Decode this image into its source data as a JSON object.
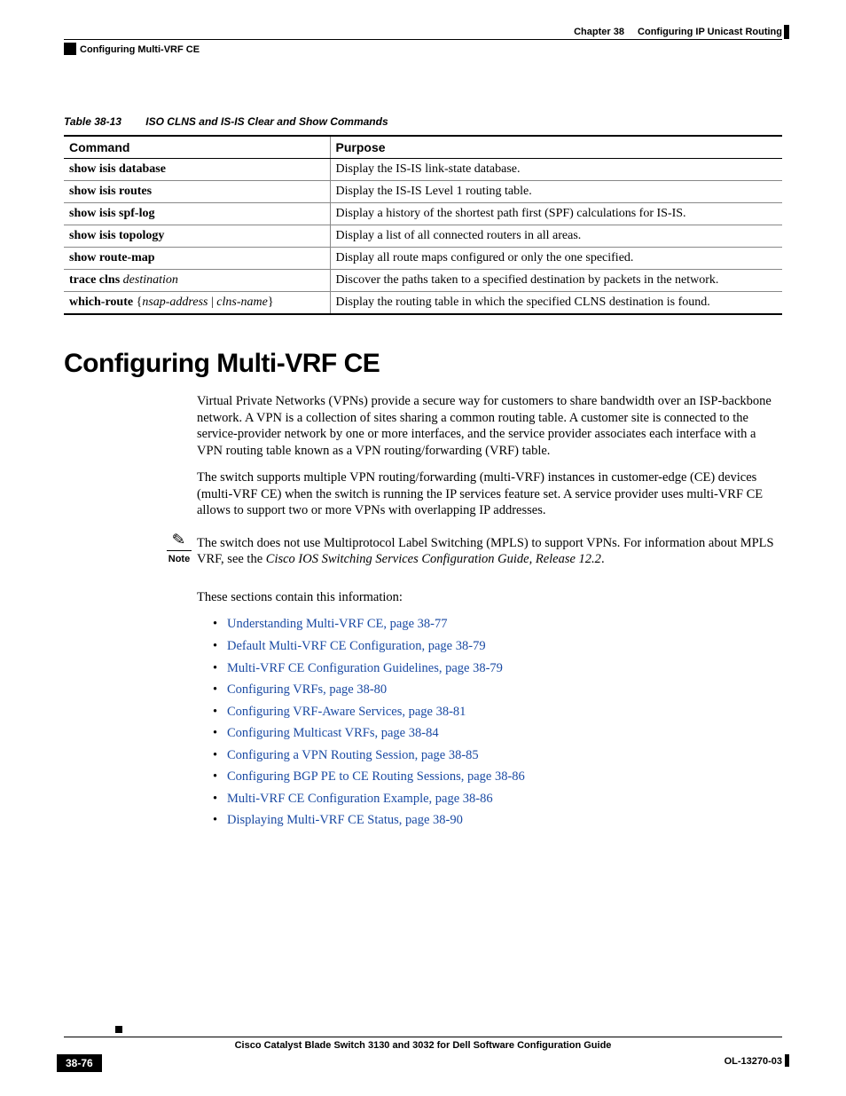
{
  "header": {
    "chapter_label": "Chapter 38",
    "chapter_title": "Configuring IP Unicast Routing",
    "section_header": "Configuring Multi-VRF CE"
  },
  "table": {
    "number": "Table 38-13",
    "title": "ISO CLNS and IS-IS Clear and Show Commands",
    "head_cmd": "Command",
    "head_purpose": "Purpose",
    "rows": [
      {
        "cmd_html": "<span class='cmd-bold'>show isis database</span>",
        "purpose": "Display the IS-IS link-state database."
      },
      {
        "cmd_html": "<span class='cmd-bold'>show isis routes</span>",
        "purpose": "Display the IS-IS Level 1 routing table."
      },
      {
        "cmd_html": "<span class='cmd-bold'>show isis spf-log</span>",
        "purpose": "Display a history of the shortest path first (SPF) calculations for IS-IS."
      },
      {
        "cmd_html": "<span class='cmd-bold'>show isis topology</span>",
        "purpose": "Display a list of all connected routers in all areas."
      },
      {
        "cmd_html": "<span class='cmd-bold'>show route-map</span>",
        "purpose": "Display all route maps configured or only the one specified."
      },
      {
        "cmd_html": "<span class='cmd-bold'>trace clns </span><span class='cmd-ital'>destination</span>",
        "purpose": "Discover the paths taken to a specified destination by packets in the network."
      },
      {
        "cmd_html": "<span class='cmd-bold'>which-route </span>{<span class='cmd-ital'>nsap-address</span> | <span class='cmd-ital'>clns-name</span>}",
        "purpose": "Display the routing table in which the specified CLNS destination is found."
      }
    ]
  },
  "section": {
    "heading": "Configuring Multi-VRF CE",
    "para1": "Virtual Private Networks (VPNs) provide a secure way for customers to share bandwidth over an ISP-backbone network. A VPN is a collection of sites sharing a common routing table. A customer site is connected to the service-provider network by one or more interfaces, and the service provider associates each interface with a VPN routing table known as a VPN routing/forwarding (VRF) table.",
    "para2": "The switch supports multiple VPN routing/forwarding (multi-VRF) instances in customer-edge (CE) devices (multi-VRF CE) when the switch is running the IP services feature set. A service provider uses multi-VRF CE allows to support two or more VPNs with overlapping IP addresses.",
    "note_label": "Note",
    "note_text_pre": "The switch does not use Multiprotocol Label Switching (MPLS) to support VPNs. For information about MPLS VRF, see the ",
    "note_text_ital": "Cisco IOS Switching Services Configuration Guide, Release 12.2",
    "note_text_post": ".",
    "para3": "These sections contain this information:",
    "links": [
      "Understanding Multi-VRF CE, page 38-77",
      "Default Multi-VRF CE Configuration, page 38-79",
      "Multi-VRF CE Configuration Guidelines, page 38-79",
      "Configuring VRFs, page 38-80",
      "Configuring VRF-Aware Services, page 38-81",
      "Configuring Multicast VRFs, page 38-84",
      "Configuring a VPN Routing Session, page 38-85",
      "Configuring BGP PE to CE Routing Sessions, page 38-86",
      "Multi-VRF CE Configuration Example, page 38-86",
      "Displaying Multi-VRF CE Status, page 38-90"
    ]
  },
  "footer": {
    "book_title": "Cisco Catalyst Blade Switch 3130 and 3032 for Dell Software Configuration Guide",
    "page_number": "38-76",
    "doc_id": "OL-13270-03"
  }
}
